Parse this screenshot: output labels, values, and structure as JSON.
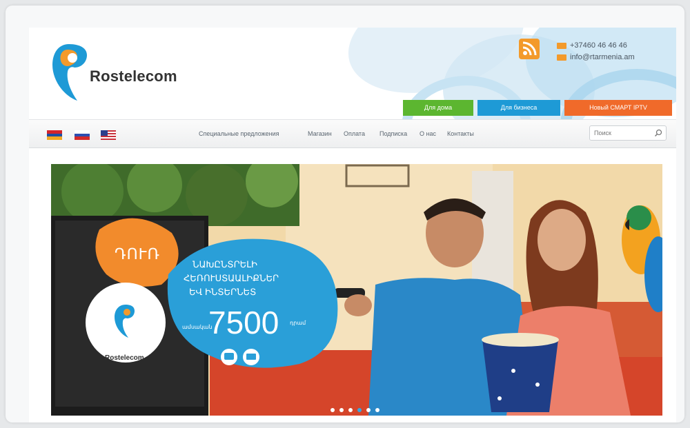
{
  "brand": {
    "name": "Rostelecom"
  },
  "contacts": {
    "phone": "+37460 46 46 46",
    "email": "info@rtarmenia.am"
  },
  "segments": [
    {
      "label": "Для дома",
      "color": "#5cb630"
    },
    {
      "label": "Для бизнеса",
      "color": "#1e9ad6"
    },
    {
      "label": "Новый СМАРТ IPTV",
      "color": "#f06a2a"
    }
  ],
  "languages": [
    "am",
    "ru",
    "en"
  ],
  "nav": {
    "items": [
      "Специальные предложения",
      "Магазин",
      "Оплата",
      "Подписка",
      "О нас",
      "Контакты"
    ]
  },
  "search": {
    "placeholder": "Поиск"
  },
  "banner": {
    "badge": "ԴՈՒՌ",
    "headline_lines": [
      "ՆԱԽԸՆՏՐԵԼԻ",
      "ՀԵՌՈՒՍՏԱԱԼԻՔՆԵՐ",
      "ԵՎ ԻՆՏԵՐՆԵՏ"
    ],
    "price_prefix": "ամսական",
    "price": "7500",
    "price_suffix": "դրամ",
    "logo_text": "Rostelecom",
    "slides_total": 6,
    "active_slide": 4
  },
  "colors": {
    "brand_orange": "#f39a2b",
    "brand_blue": "#1e9ad6",
    "bubble_blue": "#2a9fd8",
    "badge_orange": "#f28b2c"
  },
  "icons": [
    "rss-icon",
    "phone-icon",
    "email-icon",
    "search-icon",
    "tv-icon",
    "internet-icon"
  ]
}
